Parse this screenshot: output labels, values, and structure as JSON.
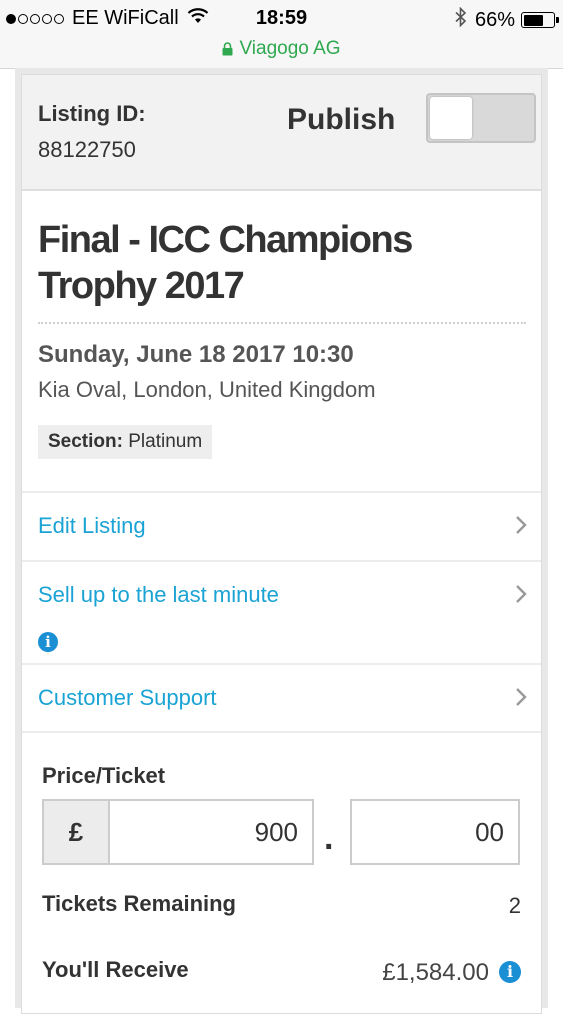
{
  "status_bar": {
    "signal_dots_filled": 1,
    "signal_dots_total": 5,
    "carrier": "EE WiFiCall",
    "time": "18:59",
    "battery": "66%",
    "battery_level": 0.66
  },
  "url_bar": {
    "site": "Viagogo AG"
  },
  "listing": {
    "id_label": "Listing ID:",
    "id_value": "88122750",
    "publish_label": "Publish",
    "publish_on": false
  },
  "event": {
    "title": "Final - ICC Champions Trophy 2017",
    "date": "Sunday, June 18 2017 10:30",
    "venue": "Kia Oval, London, United Kingdom",
    "section_label": "Section:",
    "section_value": "Platinum"
  },
  "actions": {
    "edit_listing": "Edit Listing",
    "sell_last_minute": "Sell up to the last minute",
    "customer_support": "Customer Support"
  },
  "price": {
    "label": "Price/Ticket",
    "currency": "£",
    "whole": "900",
    "decimal_separator": ".",
    "fraction": "00",
    "tickets_remaining_label": "Tickets Remaining",
    "tickets_remaining_value": "2",
    "receive_label": "You'll Receive",
    "receive_value": "£1,584.00"
  },
  "colors": {
    "link": "#1aa3d4",
    "secure_green": "#2fa84f",
    "info_blue": "#1a8fd4"
  },
  "icons": {
    "wifi": "wifi-icon",
    "bluetooth": "bluetooth-icon",
    "lock": "lock-icon",
    "chevron": "chevron-right-icon",
    "info": "info-icon"
  }
}
